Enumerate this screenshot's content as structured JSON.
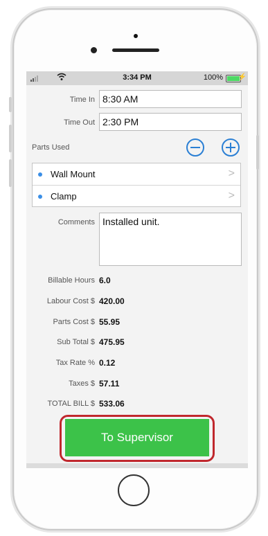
{
  "status_bar": {
    "time": "3:34 PM",
    "battery_percent": "100%",
    "battery_level": 1.0,
    "charging_icon": "bolt-icon",
    "colors": {
      "battery": "#4cd964",
      "bar": "#d6d6d6"
    }
  },
  "form": {
    "time_in": {
      "label": "Time In",
      "value": "8:30 AM"
    },
    "time_out": {
      "label": "Time Out",
      "value": "2:30 PM"
    },
    "parts_used": {
      "label": "Parts Used",
      "items": [
        {
          "label": "Wall Mount"
        },
        {
          "label": "Clamp"
        }
      ]
    },
    "comments": {
      "label": "Comments",
      "value": "Installed unit."
    }
  },
  "summary": {
    "billable_hours": {
      "label": "Billable Hours",
      "value": "6.0"
    },
    "labour_cost": {
      "label": "Labour Cost $",
      "value": "420.00"
    },
    "parts_cost": {
      "label": "Parts Cost $",
      "value": "55.95"
    },
    "sub_total": {
      "label": "Sub Total $",
      "value": "475.95"
    },
    "tax_rate": {
      "label": "Tax Rate %",
      "value": "0.12"
    },
    "taxes": {
      "label": "Taxes $",
      "value": "57.11"
    },
    "total_bill": {
      "label": "TOTAL BILL $",
      "value": "533.06"
    }
  },
  "actions": {
    "to_supervisor_label": "To Supervisor"
  },
  "colors": {
    "accent": "#2a7fd4",
    "submit_button": "#3cc249",
    "highlight_outline": "#c0272d"
  }
}
